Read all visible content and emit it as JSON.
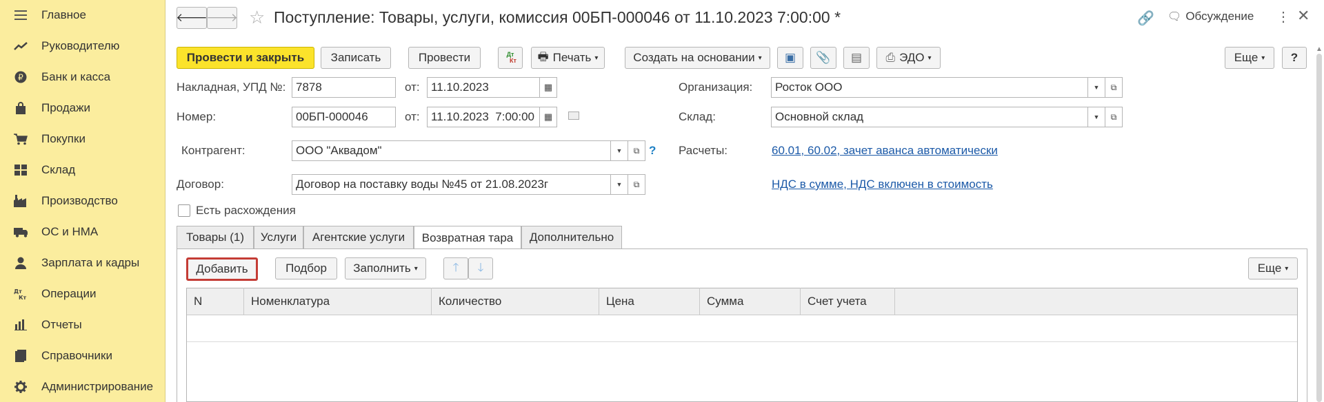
{
  "sidebar": {
    "items": [
      {
        "label": "Главное",
        "icon": "menu-icon"
      },
      {
        "label": "Руководителю",
        "icon": "trend-icon"
      },
      {
        "label": "Банк и касса",
        "icon": "ruble-icon"
      },
      {
        "label": "Продажи",
        "icon": "bag-icon"
      },
      {
        "label": "Покупки",
        "icon": "cart-icon"
      },
      {
        "label": "Склад",
        "icon": "warehouse-icon"
      },
      {
        "label": "Производство",
        "icon": "factory-icon"
      },
      {
        "label": "ОС и НМА",
        "icon": "truck-icon"
      },
      {
        "label": "Зарплата и кадры",
        "icon": "person-icon"
      },
      {
        "label": "Операции",
        "icon": "dt-kt-icon"
      },
      {
        "label": "Отчеты",
        "icon": "bar-chart-icon"
      },
      {
        "label": "Справочники",
        "icon": "book-icon"
      },
      {
        "label": "Администрирование",
        "icon": "gear-icon"
      }
    ]
  },
  "header": {
    "title": "Поступление: Товары, услуги, комиссия 00БП-000046 от 11.10.2023 7:00:00 *",
    "discussion": "Обсуждение"
  },
  "toolbar": {
    "post_close": "Провести и закрыть",
    "save": "Записать",
    "post": "Провести",
    "dtkt": "Дт Кт",
    "print": "Печать",
    "create_based": "Создать на основании",
    "edo": "ЭДО",
    "more": "Еще",
    "help": "?"
  },
  "form": {
    "invoice_label": "Накладная, УПД №:",
    "invoice_value": "7878",
    "from_label": "от:",
    "invoice_date": "11.10.2023",
    "number_label": "Номер:",
    "number_value": "00БП-000046",
    "number_date": "11.10.2023  7:00:00",
    "org_label": "Организация:",
    "org_value": "Росток ООО",
    "warehouse_label": "Склад:",
    "warehouse_value": "Основной склад",
    "counterparty_label": "Контрагент:",
    "counterparty_value": "ООО \"Аквадом\"",
    "settlements_label": "Расчеты:",
    "settlements_link": "60.01, 60.02, зачет аванса автоматически",
    "contract_label": "Договор:",
    "contract_value": "Договор на поставку воды №45 от 21.08.2023г",
    "vat_link": "НДС в сумме, НДС включен в стоимость",
    "discrepancy_label": "Есть расхождения",
    "help_mark": "?"
  },
  "tabs": [
    {
      "label": "Товары (1)"
    },
    {
      "label": "Услуги"
    },
    {
      "label": "Агентские услуги"
    },
    {
      "label": "Возвратная тара"
    },
    {
      "label": "Дополнительно"
    }
  ],
  "tab_toolbar": {
    "add": "Добавить",
    "select": "Подбор",
    "fill": "Заполнить",
    "more": "Еще"
  },
  "table": {
    "columns": [
      "N",
      "Номенклатура",
      "Количество",
      "Цена",
      "Сумма",
      "Счет учета"
    ]
  }
}
